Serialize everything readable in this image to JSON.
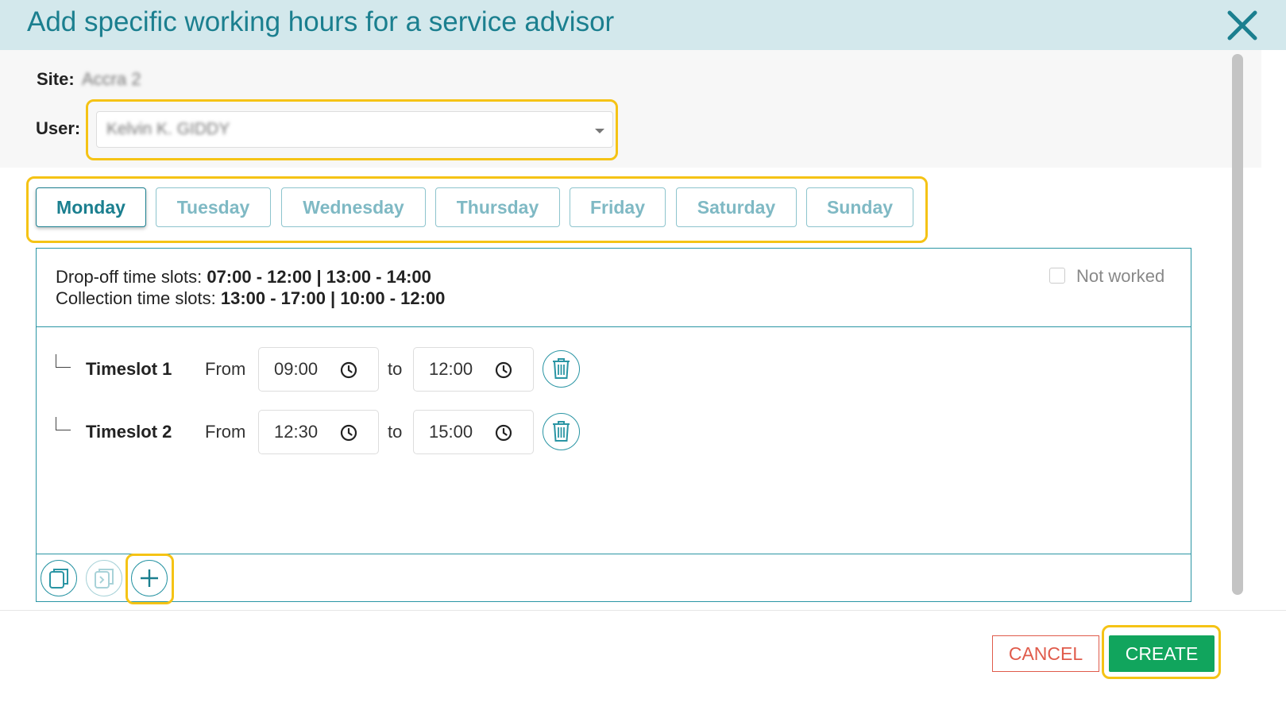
{
  "dialog": {
    "title": "Add specific working hours for a service advisor"
  },
  "site": {
    "label": "Site:",
    "value": "Accra 2"
  },
  "user": {
    "label": "User:",
    "value": "Kelvin K. GIDDY"
  },
  "days": [
    {
      "label": "Monday",
      "active": true
    },
    {
      "label": "Tuesday",
      "active": false
    },
    {
      "label": "Wednesday",
      "active": false
    },
    {
      "label": "Thursday",
      "active": false
    },
    {
      "label": "Friday",
      "active": false
    },
    {
      "label": "Saturday",
      "active": false
    },
    {
      "label": "Sunday",
      "active": false
    }
  ],
  "slots_info": {
    "dropoff_label": "Drop-off time slots: ",
    "dropoff_value": "07:00 - 12:00 | 13:00 - 14:00",
    "collection_label": "Collection time slots: ",
    "collection_value": "13:00 - 17:00 | 10:00 - 12:00",
    "not_worked_label": "Not worked",
    "not_worked_checked": false
  },
  "timeslots": [
    {
      "name": "Timeslot 1",
      "from_label": "From",
      "from": "09:00",
      "to_label": "to",
      "to": "12:00"
    },
    {
      "name": "Timeslot 2",
      "from_label": "From",
      "from": "12:30",
      "to_label": "to",
      "to": "15:00"
    }
  ],
  "footer": {
    "cancel_label": "CANCEL",
    "create_label": "CREATE"
  },
  "colors": {
    "accent": "#1b7f8f",
    "titlebar_bg": "#d3e8ec",
    "highlight": "#f5c315",
    "create": "#11a55d",
    "cancel": "#e05b4b"
  }
}
